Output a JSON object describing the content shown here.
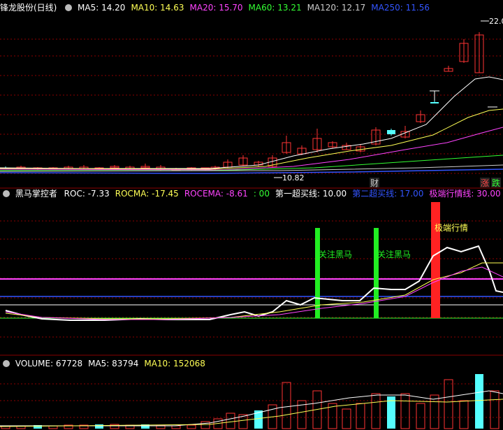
{
  "main_panel": {
    "title": "锋龙股份(日线)",
    "ma": [
      {
        "label": "MA5: 14.20",
        "color": "#ffffff"
      },
      {
        "label": "MA10: 14.63",
        "color": "#ffff55"
      },
      {
        "label": "MA20: 15.70",
        "color": "#ff44ff"
      },
      {
        "label": "MA60: 13.21",
        "color": "#33ff33"
      },
      {
        "label": "MA120: 12.17",
        "color": "#cccccc"
      },
      {
        "label": "MA250: 11.56",
        "color": "#3355ff"
      }
    ],
    "high_label": "22.0",
    "low_label": "10.82",
    "markers": {
      "cai": "财",
      "zhang": "涨",
      "die": "跌"
    }
  },
  "indicator_panel": {
    "title": "黑马掌控者",
    "labels": [
      {
        "label": "ROC: -7.33",
        "color": "#ffffff"
      },
      {
        "label": "ROCMA: -17.45",
        "color": "#ffff55"
      },
      {
        "label": "ROCEMA: -8.61",
        "color": "#ff44ff"
      },
      {
        "label": ": 00",
        "color": "#33ff33"
      },
      {
        "label": "第一超买线: 10.00",
        "color": "#ffffff"
      },
      {
        "label": "第二超买线: 17.00",
        "color": "#3355ff"
      },
      {
        "label": "极端行情线: 30.00",
        "color": "#ff44ff"
      }
    ],
    "signals": {
      "first": "关注黑马",
      "second": "关注黑马",
      "extreme": "极端行情"
    }
  },
  "volume_panel": {
    "labels": [
      {
        "label": "VOLUME: 67728",
        "color": "#ffffff"
      },
      {
        "label": "MA5: 83794",
        "color": "#ffffff"
      },
      {
        "label": "MA10: 152068",
        "color": "#ffff55"
      }
    ]
  },
  "colors": {
    "up": "#ff3333",
    "down": "#55ffff",
    "grid": "#8b0000"
  }
}
